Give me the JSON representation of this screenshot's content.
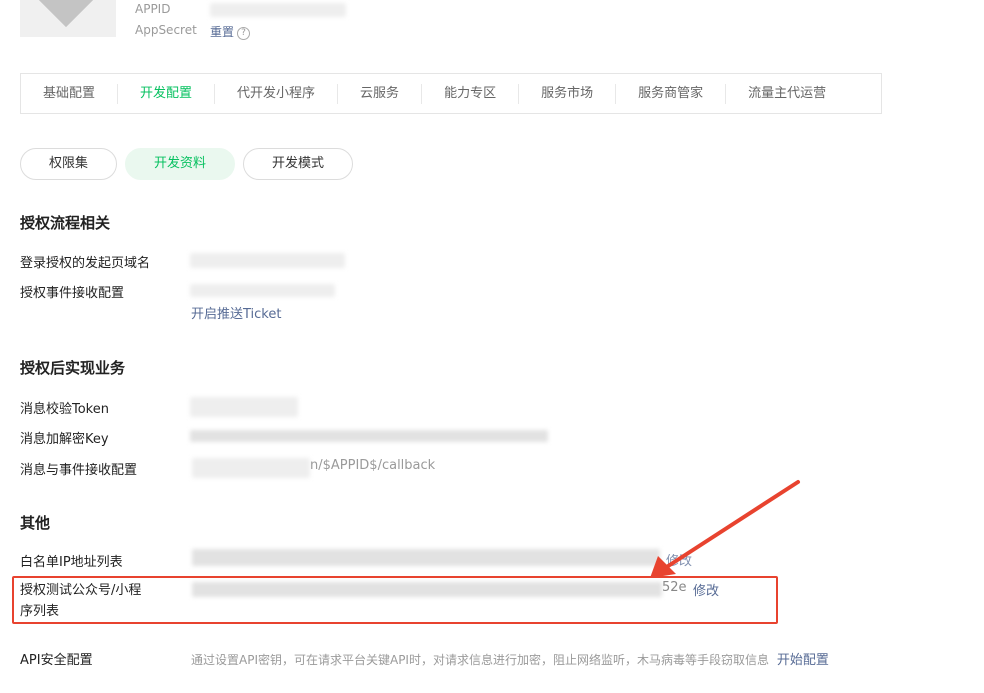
{
  "app": {
    "appid_label": "APPID",
    "appsecret_label": "AppSecret",
    "reset_link": "重置",
    "help_glyph": "?"
  },
  "tabs": [
    {
      "label": "基础配置"
    },
    {
      "label": "开发配置"
    },
    {
      "label": "代开发小程序"
    },
    {
      "label": "云服务"
    },
    {
      "label": "能力专区"
    },
    {
      "label": "服务市场"
    },
    {
      "label": "服务商管家"
    },
    {
      "label": "流量主代运营"
    }
  ],
  "active_tab": "开发配置",
  "subtabs": [
    {
      "label": "权限集"
    },
    {
      "label": "开发资料"
    },
    {
      "label": "开发模式"
    }
  ],
  "active_subtab": "开发资料",
  "sections": {
    "auth_flow": {
      "title": "授权流程相关",
      "login_domain_label": "登录授权的发起页域名",
      "event_receive_label": "授权事件接收配置",
      "push_ticket_link": "开启推送Ticket"
    },
    "post_auth": {
      "title": "授权后实现业务",
      "token_label": "消息校验Token",
      "key_label": "消息加解密Key",
      "msg_event_label": "消息与事件接收配置",
      "msg_event_value_suffix": "n/$APPID$/callback"
    },
    "other": {
      "title": "其他",
      "ip_whitelist_label": "白名单IP地址列表",
      "ip_whitelist_modify_link": "修改",
      "test_accounts_label_line1": "授权测试公众号/小程",
      "test_accounts_label_line2": "序列表",
      "test_accounts_value_suffix": "52e",
      "test_accounts_modify_link": "修改",
      "api_security_label": "API安全配置",
      "api_security_desc": "通过设置API密钥，可在请求平台关键API时，对请求信息进行加密，阻止网络监听，木马病毒等手段窃取信息",
      "api_security_link": "开始配置"
    }
  },
  "colors": {
    "accent_green": "#07c160",
    "link_blue": "#576b95",
    "annotation_red": "#e8432f"
  }
}
